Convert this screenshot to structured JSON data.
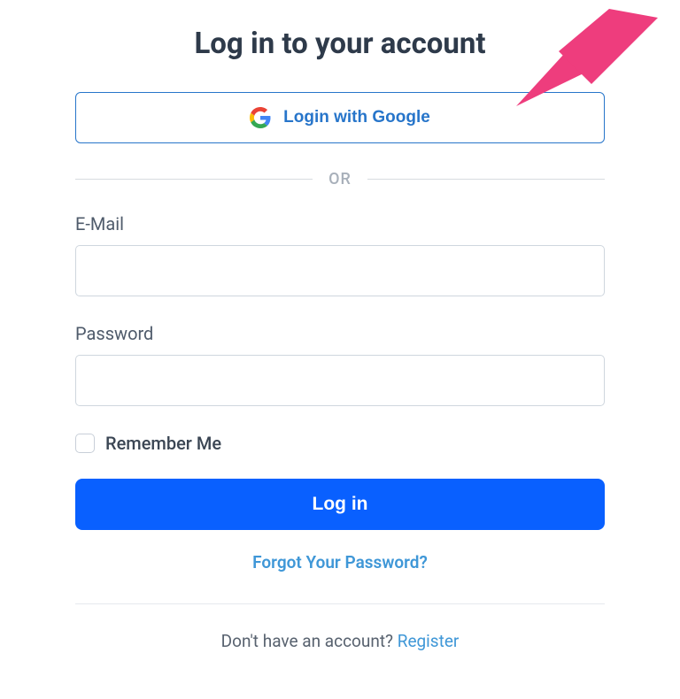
{
  "title": "Log in to your account",
  "google_button_label": "Login with Google",
  "divider_text": "OR",
  "email": {
    "label": "E-Mail",
    "value": ""
  },
  "password": {
    "label": "Password",
    "value": ""
  },
  "remember_label": "Remember Me",
  "login_button_label": "Log in",
  "forgot_link": "Forgot Your Password?",
  "register_prompt": "Don't have an account? ",
  "register_link": "Register",
  "colors": {
    "primary": "#0960ff",
    "accent": "#2775ca",
    "link": "#3f97d7"
  },
  "annotation": {
    "type": "arrow",
    "color": "#ee3d7d",
    "points_to": "google-login-button"
  }
}
